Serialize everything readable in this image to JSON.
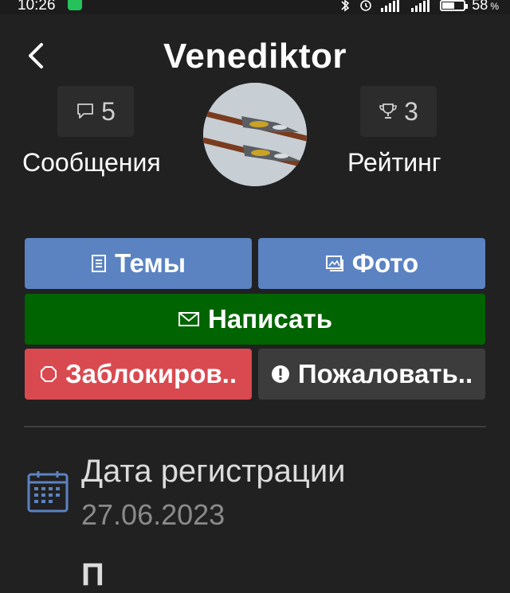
{
  "status_bar": {
    "time": "10:26",
    "battery": "58",
    "battery_unit": "%",
    "battery_level": 0.58
  },
  "header": {
    "title": "Venediktor"
  },
  "stats": {
    "messages_count": "5",
    "messages_label": "Сообщения",
    "rating_count": "3",
    "rating_label": "Рейтинг"
  },
  "buttons": {
    "topics": "Темы",
    "photo": "Фото",
    "write": "Написать",
    "block": "Заблокиров..",
    "report": "Пожаловать.."
  },
  "info": {
    "registration_label": "Дата регистрации",
    "registration_value": "27.06.2023",
    "next_label": "П"
  },
  "colors": {
    "background": "#212121",
    "blue_button": "#5b83c2",
    "green_button": "#006400",
    "red_button": "#d94a50",
    "gray_button": "#3c3c3c"
  }
}
